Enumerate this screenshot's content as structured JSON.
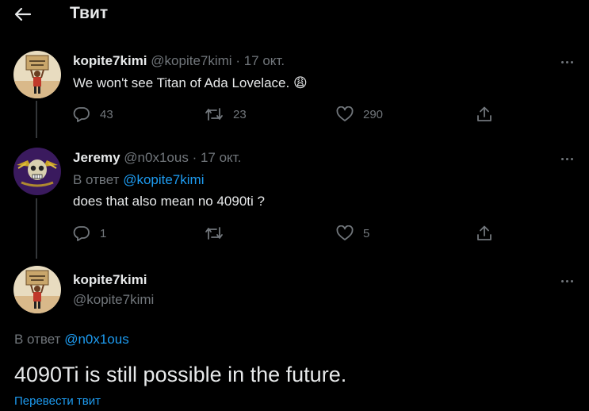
{
  "header": {
    "title": "Твит"
  },
  "tweets": [
    {
      "name": "kopite7kimi",
      "handle": "@kopite7kimi",
      "separator": "·",
      "date": "17 окт.",
      "text": "We won't see Titan of Ada Lovelace.",
      "emoji": "😩",
      "replies": "43",
      "retweets": "23",
      "likes": "290"
    },
    {
      "name": "Jeremy",
      "handle": "@n0x1ous",
      "separator": "·",
      "date": "17 окт.",
      "reply_prefix": "В ответ",
      "reply_to": "@kopite7kimi",
      "text": "does that also mean no 4090ti ?",
      "replies": "1",
      "retweets": "",
      "likes": "5"
    }
  ],
  "main_tweet": {
    "name": "kopite7kimi",
    "handle": "@kopite7kimi",
    "reply_prefix": "В ответ",
    "reply_to": "@n0x1ous",
    "text": "4090Ti is still possible in the future.",
    "translate": "Перевести твит"
  },
  "colors": {
    "background": "#000000",
    "text": "#e7e9ea",
    "muted": "#71767b",
    "accent": "#1d9bf0"
  },
  "icons": [
    "back-arrow-icon",
    "more-icon",
    "reply-icon",
    "retweet-icon",
    "like-icon",
    "share-icon"
  ]
}
